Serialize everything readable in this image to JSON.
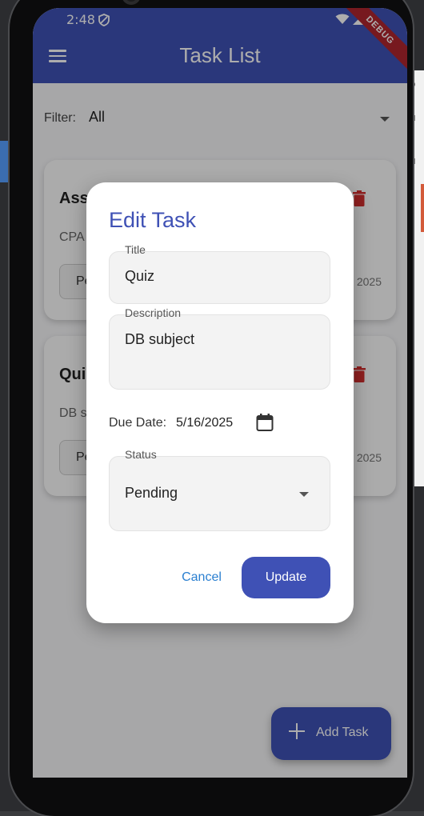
{
  "status_bar": {
    "time": "2:48"
  },
  "app_bar": {
    "title": "Task List",
    "debug_banner": "DEBUG"
  },
  "filter": {
    "label": "Filter:",
    "value": "All"
  },
  "tasks": [
    {
      "title": "Ass",
      "description": "CPA",
      "status": "Pe",
      "date": "2025"
    },
    {
      "title": "Qui",
      "description": "DB s",
      "status": "Pe",
      "date": "2025"
    }
  ],
  "fab": {
    "label": "Add Task"
  },
  "dialog": {
    "title": "Edit Task",
    "title_field": {
      "label": "Title",
      "value": "Quiz"
    },
    "description_field": {
      "label": "Description",
      "value": "DB subject"
    },
    "due_date": {
      "label": "Due Date:",
      "value": "5/16/2025"
    },
    "status_field": {
      "label": "Status",
      "value": "Pending"
    },
    "cancel_label": "Cancel",
    "update_label": "Update"
  },
  "colors": {
    "primary": "#3f51b5",
    "delete": "#d32f2f",
    "link": "#2a7fd0"
  }
}
